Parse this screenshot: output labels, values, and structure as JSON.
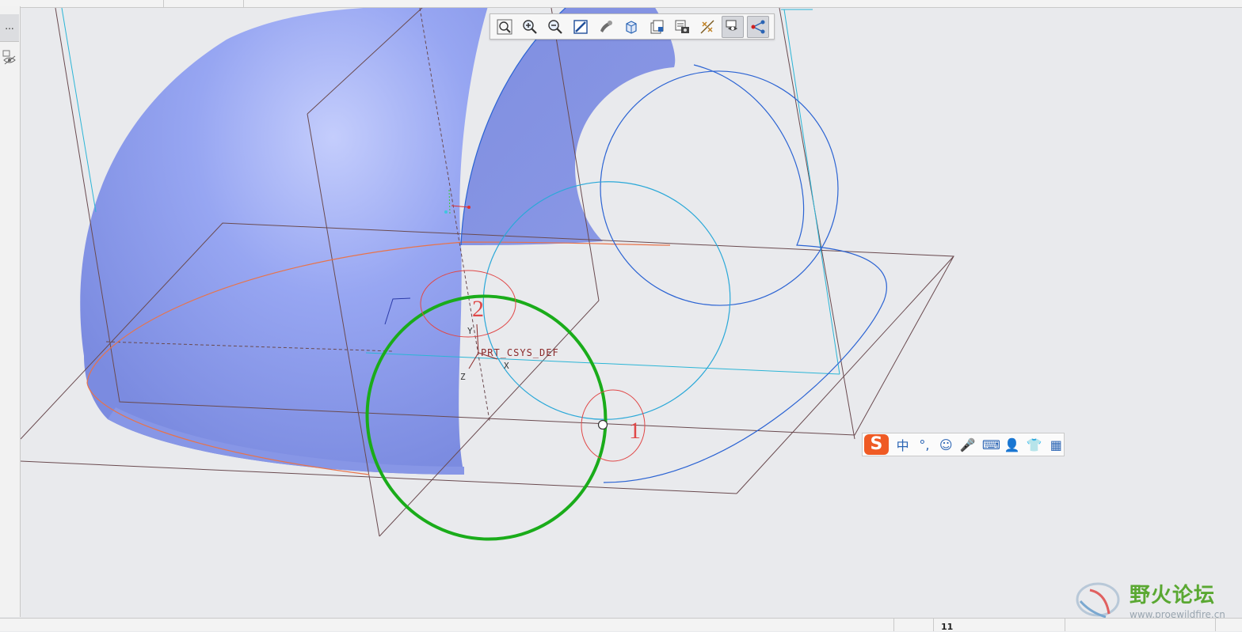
{
  "left_panel": {
    "tab_label": "..."
  },
  "viewport": {
    "csys_label": "PRT_CSYS_DEF",
    "axis_labels": {
      "x": "X",
      "y": "Y",
      "z": "Z"
    },
    "annotations": {
      "one": "1",
      "two": "2"
    }
  },
  "view_toolbar": {
    "buttons": [
      "refit-icon",
      "zoom-in-icon",
      "zoom-out-icon",
      "repaint-icon",
      "display-style-icon",
      "saved-orientations-icon",
      "named-views-icon",
      "view-manager-icon",
      "datum-display-icon",
      "annotation-display-icon",
      "spin-center-icon"
    ]
  },
  "ime_toolbar": {
    "logo": "S",
    "items": [
      "中",
      "°,",
      "☺",
      "🎤",
      "⌨",
      "👤",
      "👕",
      "▦"
    ]
  },
  "watermark": {
    "title": "野火论坛",
    "url": "www.proewildfire.cn"
  },
  "status_bar": {
    "number": "11"
  },
  "colors": {
    "surface": "#8e9ff0",
    "selected_curve": "#1aac1a",
    "annotation": "#e04848",
    "datum_plane": "#6a4a4f",
    "curve_blue": "#2b63d3",
    "curve_cyan": "#2aa8d8"
  }
}
